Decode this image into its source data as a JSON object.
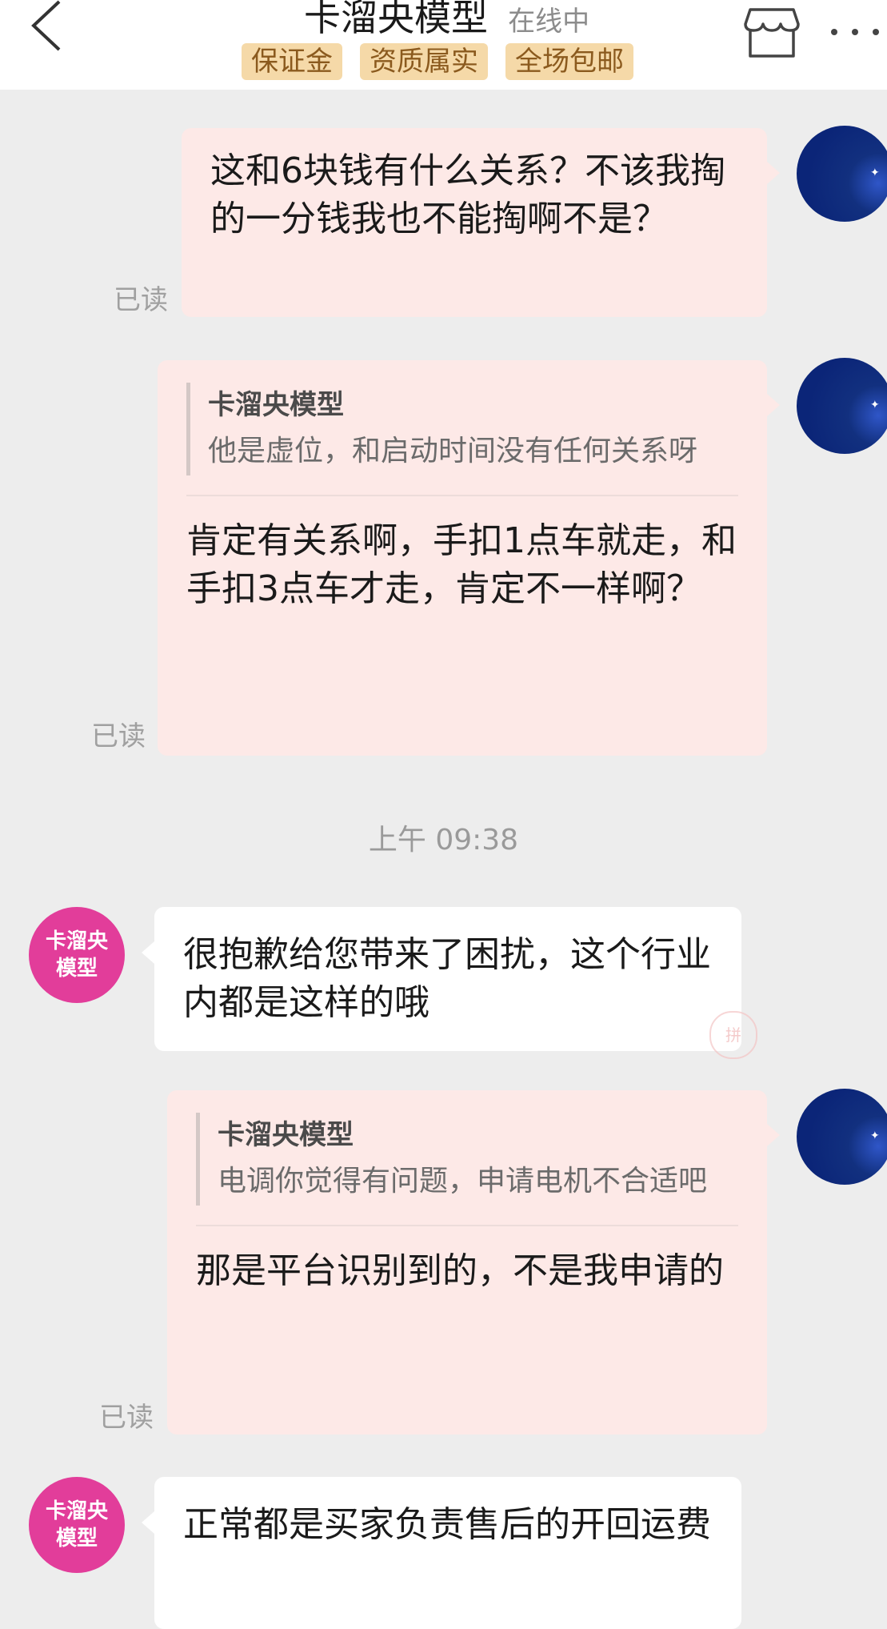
{
  "header": {
    "shop_name": "卡溜央模型",
    "status": "在线中",
    "badges": [
      "保证金",
      "资质属实",
      "全场包邮"
    ],
    "icons": {
      "back": "back-arrow-icon",
      "store": "store-icon",
      "more": "more-dots-icon"
    }
  },
  "messages": [
    {
      "sender": "me",
      "text": "这和6块钱有什么关系？不该我掏的一分钱我也不能掏啊不是？",
      "read": "已读"
    },
    {
      "sender": "me",
      "quote_name": "卡溜央模型",
      "quote_text": "他是虚位，和启动时间没有任何关系呀",
      "text": "肯定有关系啊，手扣1点车就走，和手扣3点车才走，肯定不一样啊？",
      "read": "已读"
    },
    {
      "type": "time",
      "text": "上午 09:38"
    },
    {
      "sender": "shop",
      "avatar_text": [
        "卡溜央",
        "模型"
      ],
      "text": "很抱歉给您带来了困扰，这个行业内都是这样的哦"
    },
    {
      "sender": "me",
      "quote_name": "卡溜央模型",
      "quote_text": "电调你觉得有问题，申请电机不合适吧",
      "text": "那是平台识别到的，不是我申请的",
      "read": "已读"
    },
    {
      "sender": "shop",
      "avatar_text": [
        "卡溜央",
        "模型"
      ],
      "text": "正常都是买家负责售后的开回运费"
    }
  ],
  "colors": {
    "background": "#ededed",
    "my_bubble": "#fde9e7",
    "shop_bubble": "#ffffff",
    "badge_bg": "#f5d9a8",
    "shop_avatar": "#e23d9a",
    "my_avatar": "#0b2578"
  }
}
